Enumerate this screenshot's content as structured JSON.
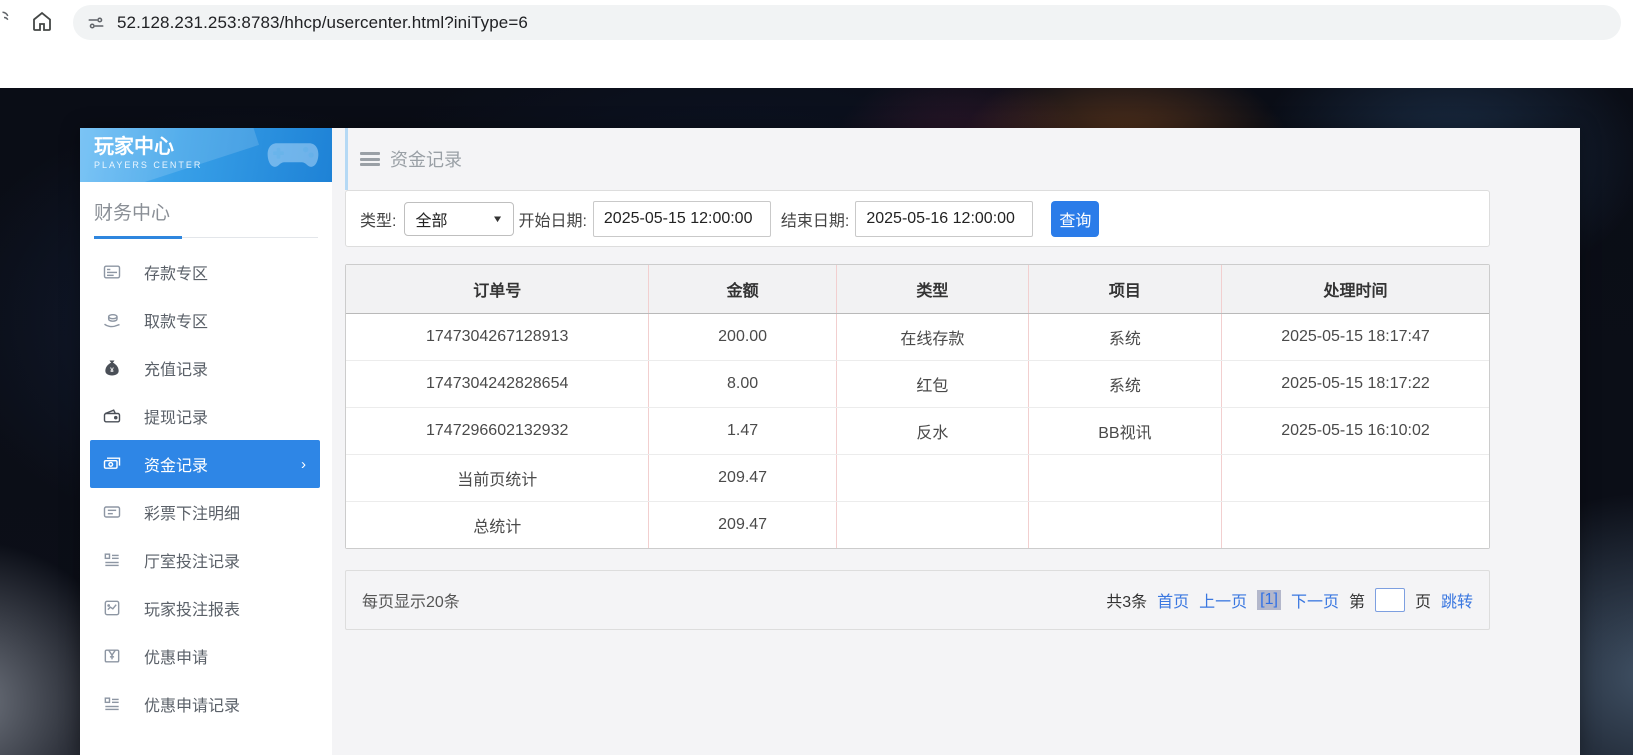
{
  "browser": {
    "url": "52.128.231.253:8783/hhcp/usercenter.html?iniType=6"
  },
  "sidebar": {
    "logo_title": "玩家中心",
    "logo_subtitle": "PLAYERS CENTER",
    "section_title": "财务中心",
    "items": [
      {
        "label": "存款专区"
      },
      {
        "label": "取款专区"
      },
      {
        "label": "充值记录"
      },
      {
        "label": "提现记录"
      },
      {
        "label": "资金记录",
        "active": true,
        "chevron": "›"
      },
      {
        "label": "彩票下注明细"
      },
      {
        "label": "厅室投注记录"
      },
      {
        "label": "玩家投注报表"
      },
      {
        "label": "优惠申请"
      },
      {
        "label": "优惠申请记录"
      }
    ]
  },
  "main": {
    "page_title": "资金记录",
    "filters": {
      "type_label": "类型:",
      "type_value": "全部",
      "start_label": "开始日期:",
      "start_value": "2025-05-15 12:00:00",
      "end_label": "结束日期:",
      "end_value": "2025-05-16 12:00:00",
      "query_label": "查询"
    },
    "table": {
      "headers": [
        "订单号",
        "金额",
        "类型",
        "项目",
        "处理时间"
      ],
      "rows": [
        [
          "1747304267128913",
          "200.00",
          "在线存款",
          "系统",
          "2025-05-15 18:17:47"
        ],
        [
          "1747304242828654",
          "8.00",
          "红包",
          "系统",
          "2025-05-15 18:17:22"
        ],
        [
          "1747296602132932",
          "1.47",
          "反水",
          "BB视讯",
          "2025-05-15 16:10:02"
        ],
        [
          "当前页统计",
          "209.47",
          "",
          "",
          ""
        ],
        [
          "总统计",
          "209.47",
          "",
          "",
          ""
        ]
      ]
    },
    "pagination": {
      "page_size_text": "每页显示20条",
      "total_text": "共3条",
      "first": "首页",
      "prev": "上一页",
      "current": "[1]",
      "next": "下一页",
      "jump_prefix": "第",
      "jump_suffix": "页",
      "jump_action": "跳转",
      "jump_value": ""
    }
  },
  "colors": {
    "accent_blue": "#2b7ce9",
    "active_item_blue": "#2e86e6",
    "link_blue": "#3a77e0",
    "table_divider_pink": "#f2cfcf"
  }
}
